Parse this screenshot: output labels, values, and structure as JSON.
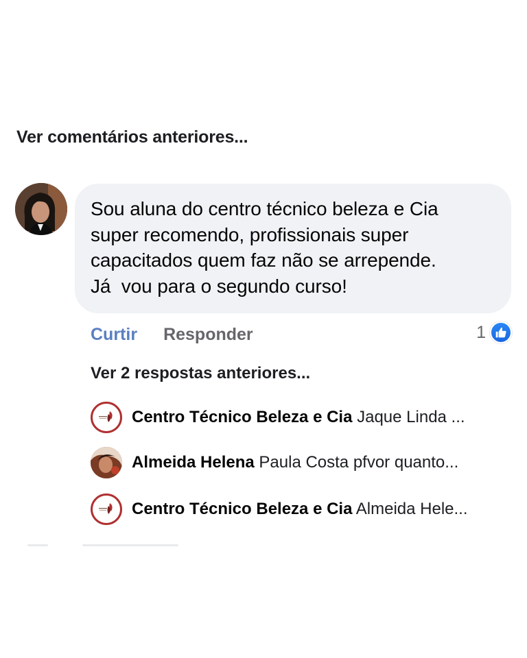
{
  "header": {
    "previous_comments_label": "Ver comentários anteriores..."
  },
  "comment": {
    "text": "Sou aluna do centro técnico beleza e Cia\nsuper recomendo, profissionais super\ncapacitados quem faz não se arrepende.\nJá  vou para o segundo curso!",
    "like_label": "Curtir",
    "reply_label": "Responder",
    "reaction_count": "1",
    "reaction_icon": "like-thumb-icon",
    "reaction_color": "#1877f2"
  },
  "replies": {
    "previous_label": "Ver 2 respostas anteriores...",
    "items": [
      {
        "name": "Centro Técnico Beleza e Cia",
        "snippet": "Jaque Linda  ..."
      },
      {
        "name": "Almeida Helena",
        "snippet": "Paula Costa pfvor quanto..."
      },
      {
        "name": "Centro Técnico Beleza e Cia",
        "snippet": "Almeida Hele..."
      }
    ]
  },
  "colors": {
    "like_action": "#5a7fc0",
    "secondary_text": "#65676b",
    "bubble_bg": "#f0f2f5",
    "brand_ring": "#b03030"
  }
}
